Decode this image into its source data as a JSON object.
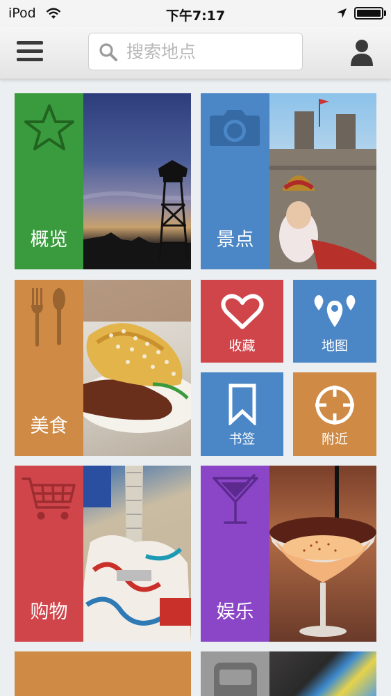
{
  "status_bar": {
    "carrier": "iPod",
    "time": "下午7:17"
  },
  "header": {
    "search_placeholder": "搜索地点"
  },
  "tiles": [
    {
      "label": "概览",
      "icon": "star-icon",
      "color": "#3a9a3e"
    },
    {
      "label": "景点",
      "icon": "camera-icon",
      "color": "#4b86c6"
    },
    {
      "label": "美食",
      "icon": "fork-spoon-icon",
      "color": "#cf8a45"
    },
    {
      "label": "购物",
      "icon": "shopping-cart-icon",
      "color": "#d0454a"
    },
    {
      "label": "娱乐",
      "icon": "cocktail-icon",
      "color": "#8a46c6"
    }
  ],
  "shortcuts": [
    {
      "label": "收藏",
      "icon": "heart-icon",
      "color": "#d0454a"
    },
    {
      "label": "地图",
      "icon": "map-pins-icon",
      "color": "#4b86c6"
    },
    {
      "label": "书签",
      "icon": "bookmark-icon",
      "color": "#4b86c6"
    },
    {
      "label": "附近",
      "icon": "crosshair-icon",
      "color": "#cf8a45"
    }
  ],
  "partial_tiles": [
    {
      "icon": "",
      "color": "#cf8a45"
    },
    {
      "icon": "bus-icon",
      "color": "#9a9a9a"
    }
  ]
}
